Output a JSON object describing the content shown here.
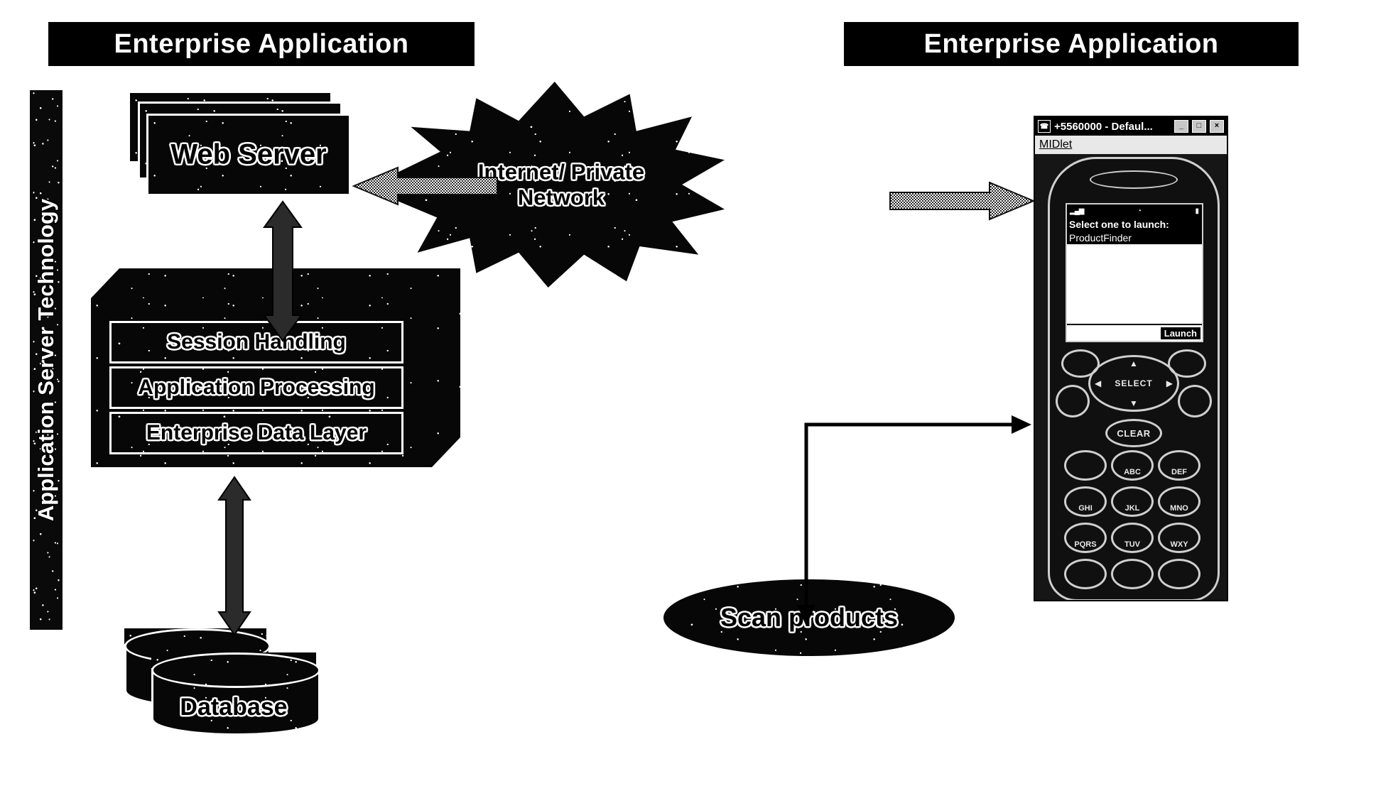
{
  "banners": {
    "left": "Enterprise Application",
    "right": "Enterprise Application"
  },
  "sidebar": {
    "vertical_label": "Application Server Technology"
  },
  "nodes": {
    "web_server": "Web Server",
    "database": "Database",
    "scan_products": "Scan products",
    "network_line1": "Internet/ Private",
    "network_line2": "Network"
  },
  "app_server_layers": [
    {
      "label": "Session Handling"
    },
    {
      "label": "Application Processing"
    },
    {
      "label": "Enterprise Data Layer"
    }
  ],
  "phone": {
    "window_title": "+5560000 - Defaul...",
    "sys_icon": "☎",
    "window_buttons": [
      {
        "name": "minimize",
        "glyph": "_"
      },
      {
        "name": "maximize",
        "glyph": "□"
      },
      {
        "name": "close",
        "glyph": "×"
      }
    ],
    "menu_items": [
      "MIDlet"
    ],
    "screen": {
      "signal": "▂▄▆",
      "battery": "▮",
      "clock_icon": "◔",
      "title": "Select one to launch:",
      "list_items": [
        "ProductFinder"
      ],
      "softkey_right": "Launch"
    },
    "nav": {
      "select": "SELECT",
      "up": "▲",
      "down": "▼",
      "left": "◀",
      "right": "▶"
    },
    "clear_key": "CLEAR",
    "keypad": [
      "",
      "ABC",
      "DEF",
      "GHI",
      "JKL",
      "MNO",
      "PQRS",
      "TUV",
      "WXY",
      "",
      "",
      ""
    ]
  },
  "colors": {
    "background": "#ffffff",
    "ink": "#000000",
    "outline": "#ffffff",
    "banner_bg": "#000000",
    "banner_text": "#ffffff",
    "phone_chrome": "#9a9a9a"
  }
}
